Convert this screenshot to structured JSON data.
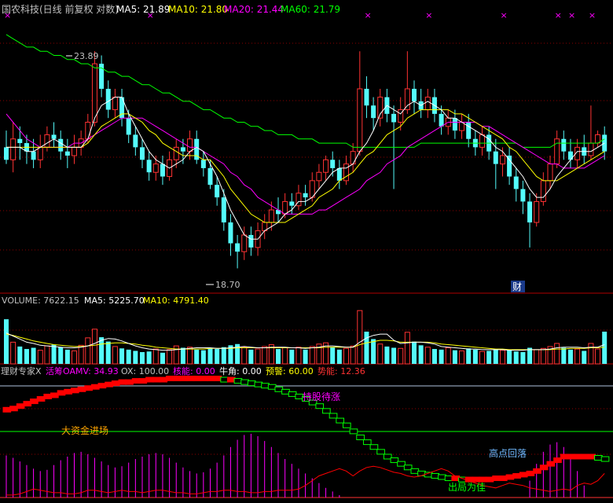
{
  "colors": {
    "bg": "#000000",
    "up": "#ff3232",
    "down": "#54fcfc",
    "grid": "#8b0000",
    "ma5": "#ffffff",
    "ma10": "#ffff00",
    "ma20": "#ff00ff",
    "ma60": "#00ff00",
    "label": "#c0c0c0",
    "hl": "#ffffff",
    "red": "#ff0000",
    "green": "#00ff00",
    "magenta": "#ff00ff",
    "yellow": "#ffff00",
    "orange": "#ffa500",
    "cyan": "#54fcfc",
    "blueLabel": "#6fb8ff"
  },
  "header": {
    "title": "国农科技(日线 前复权 对数)",
    "ma5": "MA5: 21.89",
    "ma10": "MA10: 21.80",
    "ma20": "MA20: 21.44",
    "ma60": "MA60: 21.79"
  },
  "annotations": {
    "high": "23.89",
    "low": "18.70",
    "cai": "财"
  },
  "volume_header": {
    "volume": "VOLUME: 7622.15",
    "ma5": "MA5: 5225.70",
    "ma10": "MA10: 4791.40"
  },
  "indicator_header": {
    "name": "理财专家X",
    "oamv": "活筹OAMV: 34.93",
    "ox": "OX: 100.00",
    "hn": "核能: 0.00",
    "nj": "牛角: 0.00",
    "yj": "预警: 60.00",
    "sn": "势能: 12.36"
  },
  "indicator_labels": {
    "hold": "持股待涨",
    "big": "大资金进场",
    "top": "高点回落",
    "exit": "出局为佳"
  },
  "markers": {
    "x_symbol": "×"
  },
  "chart_data": {
    "type": "candlestick",
    "price_range": [
      18.2,
      24.6
    ],
    "volume_range": [
      0,
      9000
    ],
    "indicator_range": [
      0,
      100
    ],
    "candles": [
      [
        21.6,
        21.3,
        22.0,
        21.2
      ],
      [
        21.3,
        21.8,
        22.2,
        21.0
      ],
      [
        21.8,
        21.7,
        22.1,
        21.3
      ],
      [
        21.7,
        21.5,
        21.9,
        21.2
      ],
      [
        21.5,
        21.3,
        21.8,
        21.1
      ],
      [
        21.3,
        21.6,
        21.9,
        21.1
      ],
      [
        21.6,
        21.9,
        22.1,
        21.5
      ],
      [
        21.9,
        21.8,
        22.2,
        21.6
      ],
      [
        21.8,
        21.5,
        22.0,
        21.3
      ],
      [
        21.5,
        21.4,
        21.8,
        21.1
      ],
      [
        21.4,
        21.6,
        21.9,
        21.2
      ],
      [
        21.6,
        21.8,
        22.0,
        21.4
      ],
      [
        21.8,
        22.2,
        22.4,
        21.7
      ],
      [
        22.2,
        23.6,
        23.9,
        22.1
      ],
      [
        23.6,
        23.0,
        23.8,
        22.8
      ],
      [
        23.0,
        22.5,
        23.2,
        22.3
      ],
      [
        22.5,
        22.8,
        23.0,
        22.3
      ],
      [
        22.8,
        22.3,
        23.0,
        22.1
      ],
      [
        22.3,
        21.9,
        22.5,
        21.7
      ],
      [
        21.9,
        21.6,
        22.1,
        21.4
      ],
      [
        21.6,
        21.3,
        21.8,
        21.1
      ],
      [
        21.3,
        21.0,
        21.5,
        20.8
      ],
      [
        21.0,
        21.2,
        21.4,
        20.8
      ],
      [
        21.2,
        20.9,
        21.4,
        20.7
      ],
      [
        20.9,
        21.3,
        21.5,
        20.8
      ],
      [
        21.3,
        21.6,
        21.8,
        21.1
      ],
      [
        21.6,
        21.5,
        21.8,
        21.2
      ],
      [
        21.5,
        21.8,
        22.0,
        21.3
      ],
      [
        21.8,
        21.3,
        22.0,
        21.2
      ],
      [
        21.3,
        21.1,
        21.5,
        20.9
      ],
      [
        21.1,
        20.7,
        21.3,
        20.6
      ],
      [
        20.7,
        20.4,
        20.9,
        20.2
      ],
      [
        20.4,
        19.8,
        20.6,
        19.6
      ],
      [
        19.8,
        19.3,
        20.0,
        19.0
      ],
      [
        19.3,
        19.1,
        19.5,
        18.7
      ],
      [
        19.1,
        19.5,
        19.7,
        18.9
      ],
      [
        19.5,
        19.2,
        19.7,
        19.0
      ],
      [
        19.2,
        19.6,
        19.8,
        19.0
      ],
      [
        19.6,
        19.8,
        20.0,
        19.4
      ],
      [
        19.8,
        20.1,
        20.3,
        19.6
      ],
      [
        20.1,
        20.0,
        20.4,
        19.8
      ],
      [
        20.0,
        20.3,
        20.5,
        19.9
      ],
      [
        20.3,
        20.2,
        20.5,
        20.0
      ],
      [
        20.2,
        20.5,
        20.7,
        20.1
      ],
      [
        20.5,
        20.4,
        20.7,
        20.2
      ],
      [
        20.4,
        20.8,
        21.0,
        20.3
      ],
      [
        20.8,
        21.0,
        21.2,
        20.6
      ],
      [
        21.0,
        21.3,
        21.4,
        20.8
      ],
      [
        21.3,
        21.1,
        21.5,
        20.9
      ],
      [
        21.1,
        20.8,
        21.3,
        20.6
      ],
      [
        20.8,
        21.2,
        21.4,
        20.7
      ],
      [
        21.2,
        21.5,
        21.7,
        21.0
      ],
      [
        21.5,
        23.0,
        23.9,
        21.4
      ],
      [
        23.0,
        22.6,
        23.3,
        22.3
      ],
      [
        22.6,
        22.3,
        22.8,
        22.0
      ],
      [
        22.3,
        22.8,
        23.0,
        22.1
      ],
      [
        22.8,
        22.4,
        23.0,
        22.2
      ],
      [
        22.4,
        22.2,
        22.6,
        20.6
      ],
      [
        22.2,
        22.5,
        22.8,
        22.0
      ],
      [
        22.5,
        23.0,
        23.9,
        22.4
      ],
      [
        23.0,
        22.7,
        23.2,
        22.4
      ],
      [
        22.7,
        22.5,
        23.0,
        22.3
      ],
      [
        22.5,
        22.8,
        23.0,
        22.3
      ],
      [
        22.8,
        22.4,
        23.0,
        22.2
      ],
      [
        22.4,
        22.1,
        22.6,
        21.9
      ],
      [
        22.1,
        22.3,
        22.5,
        21.9
      ],
      [
        22.3,
        22.0,
        22.5,
        21.8
      ],
      [
        22.0,
        22.2,
        22.4,
        21.8
      ],
      [
        22.2,
        21.8,
        22.4,
        21.6
      ],
      [
        21.8,
        21.6,
        22.0,
        21.4
      ],
      [
        21.6,
        21.9,
        22.1,
        21.4
      ],
      [
        21.9,
        21.5,
        22.1,
        21.3
      ],
      [
        21.5,
        21.2,
        21.8,
        20.6
      ],
      [
        21.2,
        21.4,
        21.6,
        20.9
      ],
      [
        21.4,
        20.9,
        21.6,
        20.7
      ],
      [
        20.9,
        20.6,
        21.1,
        20.3
      ],
      [
        20.6,
        20.3,
        20.8,
        20.0
      ],
      [
        20.3,
        19.8,
        20.5,
        19.2
      ],
      [
        19.8,
        20.3,
        20.5,
        19.7
      ],
      [
        20.3,
        20.8,
        21.0,
        20.2
      ],
      [
        20.8,
        21.2,
        21.4,
        20.6
      ],
      [
        21.2,
        21.8,
        22.0,
        21.1
      ],
      [
        21.8,
        21.5,
        22.0,
        21.3
      ],
      [
        21.5,
        21.3,
        21.8,
        21.1
      ],
      [
        21.3,
        21.6,
        21.8,
        21.1
      ],
      [
        21.6,
        21.4,
        21.9,
        21.2
      ],
      [
        21.4,
        21.7,
        22.6,
        21.3
      ],
      [
        21.7,
        21.9,
        22.0,
        21.6
      ],
      [
        21.9,
        21.5,
        22.1,
        21.3
      ]
    ],
    "ma5": [
      21.6,
      21.6,
      21.6,
      21.5,
      21.5,
      21.6,
      21.7,
      21.8,
      21.7,
      21.6,
      21.6,
      21.6,
      21.8,
      22.3,
      22.6,
      22.7,
      22.8,
      22.8,
      22.4,
      22.1,
      21.8,
      21.5,
      21.3,
      21.2,
      21.1,
      21.2,
      21.3,
      21.5,
      21.6,
      21.5,
      21.2,
      20.9,
      20.5,
      20.1,
      19.8,
      19.5,
      19.4,
      19.4,
      19.6,
      19.7,
      19.8,
      20.0,
      20.1,
      20.3,
      20.3,
      20.4,
      20.6,
      20.8,
      21.0,
      21.1,
      21.1,
      21.2,
      21.5,
      21.7,
      22.0,
      22.4,
      22.6,
      22.5,
      22.4,
      22.6,
      22.7,
      22.6,
      22.7,
      22.6,
      22.5,
      22.3,
      22.3,
      22.2,
      22.1,
      22.0,
      21.9,
      21.8,
      21.6,
      21.5,
      21.3,
      21.1,
      20.9,
      20.6,
      20.4,
      20.4,
      20.6,
      20.9,
      21.1,
      21.3,
      21.5,
      21.5,
      21.5,
      21.6,
      21.7
    ],
    "ma10": [
      21.6,
      21.6,
      21.6,
      21.6,
      21.6,
      21.6,
      21.6,
      21.6,
      21.6,
      21.6,
      21.6,
      21.6,
      21.7,
      21.9,
      22.1,
      22.2,
      22.3,
      22.4,
      22.4,
      22.3,
      22.2,
      22.0,
      21.9,
      21.7,
      21.6,
      21.5,
      21.4,
      21.4,
      21.4,
      21.3,
      21.3,
      21.1,
      20.9,
      20.6,
      20.4,
      20.2,
      20.0,
      19.9,
      19.8,
      19.8,
      19.8,
      19.8,
      19.9,
      20.0,
      20.1,
      20.2,
      20.4,
      20.5,
      20.6,
      20.8,
      20.9,
      21.0,
      21.2,
      21.4,
      21.5,
      21.7,
      21.9,
      22.0,
      22.1,
      22.3,
      22.4,
      22.5,
      22.5,
      22.5,
      22.5,
      22.5,
      22.4,
      22.4,
      22.3,
      22.2,
      22.1,
      22.0,
      21.9,
      21.8,
      21.6,
      21.5,
      21.3,
      21.1,
      20.9,
      20.8,
      20.8,
      20.8,
      20.9,
      21.0,
      21.1,
      21.2,
      21.3,
      21.4,
      21.5
    ],
    "ma20": [
      22.4,
      22.2,
      22.0,
      21.8,
      21.7,
      21.6,
      21.6,
      21.6,
      21.6,
      21.6,
      21.7,
      21.7,
      21.8,
      21.9,
      22.0,
      22.1,
      22.2,
      22.3,
      22.3,
      22.3,
      22.3,
      22.2,
      22.1,
      22.0,
      21.9,
      21.8,
      21.7,
      21.6,
      21.6,
      21.5,
      21.4,
      21.3,
      21.2,
      21.0,
      20.9,
      20.7,
      20.6,
      20.4,
      20.3,
      20.2,
      20.1,
      20.0,
      20.0,
      20.0,
      20.0,
      20.0,
      20.1,
      20.1,
      20.2,
      20.3,
      20.4,
      20.5,
      20.6,
      20.8,
      20.9,
      21.0,
      21.2,
      21.3,
      21.4,
      21.6,
      21.7,
      21.8,
      21.9,
      22.0,
      22.1,
      22.2,
      22.2,
      22.2,
      22.2,
      22.2,
      22.1,
      22.1,
      22.0,
      21.9,
      21.8,
      21.7,
      21.6,
      21.5,
      21.4,
      21.3,
      21.2,
      21.2,
      21.1,
      21.1,
      21.1,
      21.1,
      21.2,
      21.3,
      21.4
    ],
    "ma60": [
      24.3,
      24.2,
      24.1,
      24.0,
      24.0,
      23.9,
      23.9,
      23.8,
      23.8,
      23.7,
      23.7,
      23.6,
      23.6,
      23.5,
      23.5,
      23.4,
      23.4,
      23.3,
      23.3,
      23.2,
      23.1,
      23.1,
      23.0,
      22.9,
      22.9,
      22.8,
      22.7,
      22.7,
      22.6,
      22.5,
      22.5,
      22.4,
      22.3,
      22.3,
      22.2,
      22.2,
      22.1,
      22.1,
      22.0,
      22.0,
      21.9,
      21.9,
      21.9,
      21.8,
      21.8,
      21.8,
      21.7,
      21.7,
      21.7,
      21.7,
      21.7,
      21.6,
      21.6,
      21.6,
      21.6,
      21.6,
      21.6,
      21.6,
      21.6,
      21.6,
      21.6,
      21.7,
      21.7,
      21.7,
      21.7,
      21.7,
      21.7,
      21.7,
      21.7,
      21.7,
      21.7,
      21.7,
      21.7,
      21.7,
      21.7,
      21.7,
      21.6,
      21.6,
      21.6,
      21.6,
      21.6,
      21.7,
      21.7,
      21.7,
      21.7,
      21.7,
      21.7,
      21.7,
      21.8
    ],
    "volume": [
      7200,
      3500,
      2800,
      2400,
      2600,
      2200,
      2900,
      3100,
      2700,
      2300,
      2100,
      3000,
      4200,
      5600,
      4300,
      3600,
      2800,
      2500,
      2300,
      2100,
      1900,
      2000,
      2400,
      1800,
      2300,
      2900,
      2600,
      2700,
      2300,
      2200,
      2600,
      2400,
      2700,
      3000,
      3200,
      2700,
      2300,
      2400,
      2800,
      3100,
      2400,
      2600,
      2300,
      2700,
      2300,
      2800,
      3200,
      3400,
      2700,
      2300,
      2500,
      2900,
      8600,
      5200,
      4000,
      3200,
      2800,
      2600,
      2500,
      5100,
      3600,
      3000,
      2700,
      2400,
      2300,
      2600,
      2200,
      2100,
      2500,
      2300,
      2000,
      2100,
      2400,
      2200,
      2300,
      2000,
      1900,
      2600,
      2300,
      2500,
      2800,
      3300,
      2600,
      2300,
      2400,
      2100,
      3300,
      2400,
      5200
    ],
    "vol_ma5": [
      5000,
      4500,
      4000,
      3500,
      3300,
      3000,
      2900,
      2800,
      2700,
      2600,
      2600,
      2700,
      2900,
      3300,
      3800,
      4100,
      4000,
      3700,
      3300,
      2900,
      2600,
      2400,
      2300,
      2200,
      2200,
      2300,
      2400,
      2500,
      2600,
      2600,
      2600,
      2500,
      2500,
      2600,
      2700,
      2800,
      2700,
      2600,
      2600,
      2700,
      2700,
      2700,
      2600,
      2600,
      2500,
      2600,
      2700,
      2900,
      2900,
      2800,
      2700,
      2700,
      3500,
      4200,
      4600,
      4800,
      4800,
      3800,
      3300,
      3400,
      3500,
      3500,
      3400,
      3200,
      2800,
      2700,
      2600,
      2500,
      2400,
      2400,
      2300,
      2300,
      2300,
      2300,
      2200,
      2200,
      2200,
      2300,
      2300,
      2300,
      2400,
      2600,
      2700,
      2700,
      2700,
      2600,
      2700,
      2700,
      3100
    ],
    "vol_ma10": [
      4800,
      4600,
      4300,
      4000,
      3700,
      3500,
      3300,
      3100,
      3000,
      2900,
      2800,
      2800,
      2900,
      3000,
      3200,
      3300,
      3400,
      3400,
      3300,
      3200,
      3000,
      2900,
      2700,
      2600,
      2500,
      2400,
      2400,
      2400,
      2400,
      2400,
      2500,
      2500,
      2500,
      2500,
      2600,
      2600,
      2600,
      2600,
      2600,
      2600,
      2600,
      2600,
      2600,
      2600,
      2600,
      2600,
      2600,
      2700,
      2700,
      2700,
      2700,
      2700,
      3100,
      3400,
      3600,
      3800,
      3800,
      3700,
      3500,
      3500,
      3500,
      3500,
      3500,
      3400,
      3200,
      3100,
      3000,
      2900,
      2800,
      2700,
      2600,
      2500,
      2400,
      2400,
      2300,
      2300,
      2300,
      2300,
      2300,
      2300,
      2300,
      2400,
      2400,
      2500,
      2500,
      2500,
      2600,
      2600,
      2700
    ],
    "indicator": {
      "oamv_steps": [
        73,
        74,
        76,
        78,
        80,
        82,
        84,
        85,
        87,
        88,
        89,
        90,
        91,
        92,
        93,
        94,
        95,
        96,
        96,
        97,
        97,
        98,
        98,
        98,
        99,
        99,
        99,
        99,
        99,
        99,
        99,
        99,
        98,
        98,
        97,
        96,
        95,
        94,
        93,
        92,
        90,
        88,
        86,
        84,
        82,
        79,
        76,
        72,
        68,
        64,
        60,
        55,
        50,
        46,
        42,
        38,
        34,
        31,
        28,
        25,
        22,
        20,
        19,
        18,
        17,
        16,
        16,
        15,
        15,
        15,
        15,
        15,
        16,
        16,
        17,
        18,
        19,
        20,
        22,
        25,
        28,
        31,
        34,
        34,
        34,
        34,
        34,
        33,
        32
      ],
      "bars": [
        35,
        33,
        30,
        27,
        24,
        22,
        23,
        27,
        31,
        34,
        37,
        38,
        36,
        33,
        30,
        27,
        25,
        26,
        29,
        32,
        34,
        36,
        37,
        36,
        33,
        29,
        25,
        22,
        20,
        21,
        24,
        29,
        35,
        42,
        48,
        52,
        53,
        51,
        47,
        42,
        37,
        32,
        28,
        24,
        20,
        16,
        12,
        8,
        5,
        2,
        0,
        0,
        0,
        0,
        0,
        0,
        0,
        0,
        0,
        0,
        0,
        0,
        0,
        0,
        0,
        0,
        0,
        0,
        0,
        0,
        0,
        0,
        0,
        0,
        0,
        0,
        0,
        14,
        28,
        38,
        44,
        46,
        42,
        34,
        22,
        10,
        0,
        0,
        0
      ],
      "red_line": [
        2,
        2,
        3,
        5,
        7,
        6,
        5,
        4,
        4,
        3,
        3,
        4,
        6,
        6,
        5,
        4,
        5,
        6,
        5,
        5,
        4,
        5,
        6,
        6,
        5,
        4,
        4,
        3,
        3,
        4,
        5,
        5,
        6,
        6,
        5,
        5,
        4,
        4,
        5,
        5,
        6,
        6,
        6,
        7,
        10,
        14,
        18,
        20,
        22,
        24,
        22,
        18,
        22,
        25,
        26,
        25,
        23,
        21,
        20,
        18,
        17,
        18,
        20,
        22,
        24,
        22,
        18,
        16,
        14,
        12,
        10,
        9,
        8,
        10,
        12,
        11,
        10,
        8,
        7,
        6,
        5,
        6,
        7,
        6,
        10,
        12,
        11,
        14,
        20
      ]
    },
    "title": "国农科技(日线 前复权 对数)",
    "annotations": [
      "23.89",
      "18.70"
    ]
  }
}
